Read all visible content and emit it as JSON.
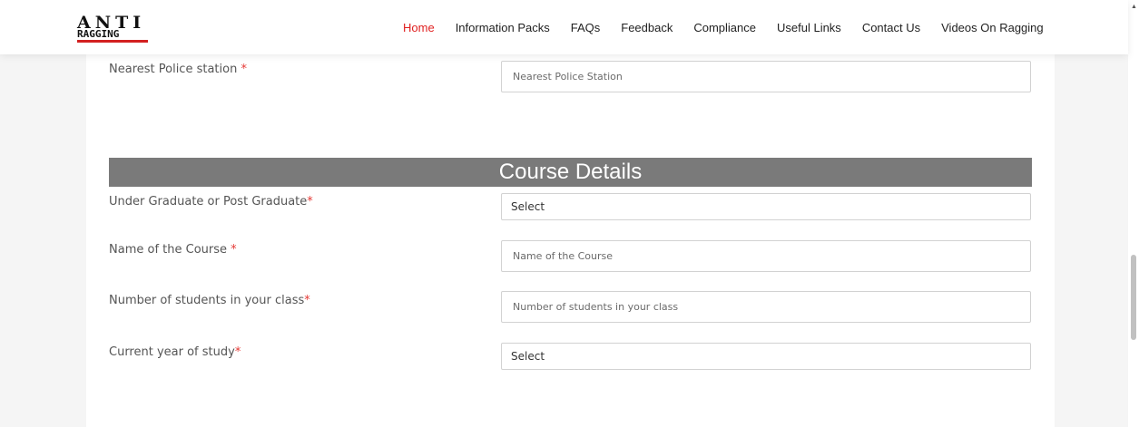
{
  "header": {
    "logo": {
      "line1": "ANTI",
      "line2": "RAGGING"
    },
    "nav": [
      "Home",
      "Information Packs",
      "FAQs",
      "Feedback",
      "Compliance",
      "Useful Links",
      "Contact Us",
      "Videos On Ragging"
    ],
    "active_nav": "Home"
  },
  "form": {
    "police_station": {
      "label": "Nearest Police station",
      "required": "*",
      "placeholder": "Nearest Police Station"
    },
    "section_title": "Course Details",
    "ug_pg": {
      "label": "Under Graduate or Post Graduate",
      "required": "*",
      "value": "Select"
    },
    "course_name": {
      "label": "Name of the Course",
      "required": "*",
      "placeholder": "Name of the Course"
    },
    "students": {
      "label": "Number of students in your class",
      "required": "*",
      "placeholder": "Number of students in your class"
    },
    "year": {
      "label": "Current year of study",
      "required": "*",
      "value": "Select"
    }
  },
  "colors": {
    "accent": "#e02020",
    "required": "#e53935",
    "section_bar": "#7a7a7a"
  },
  "icons": [
    "scroll-up-arrow-icon"
  ]
}
